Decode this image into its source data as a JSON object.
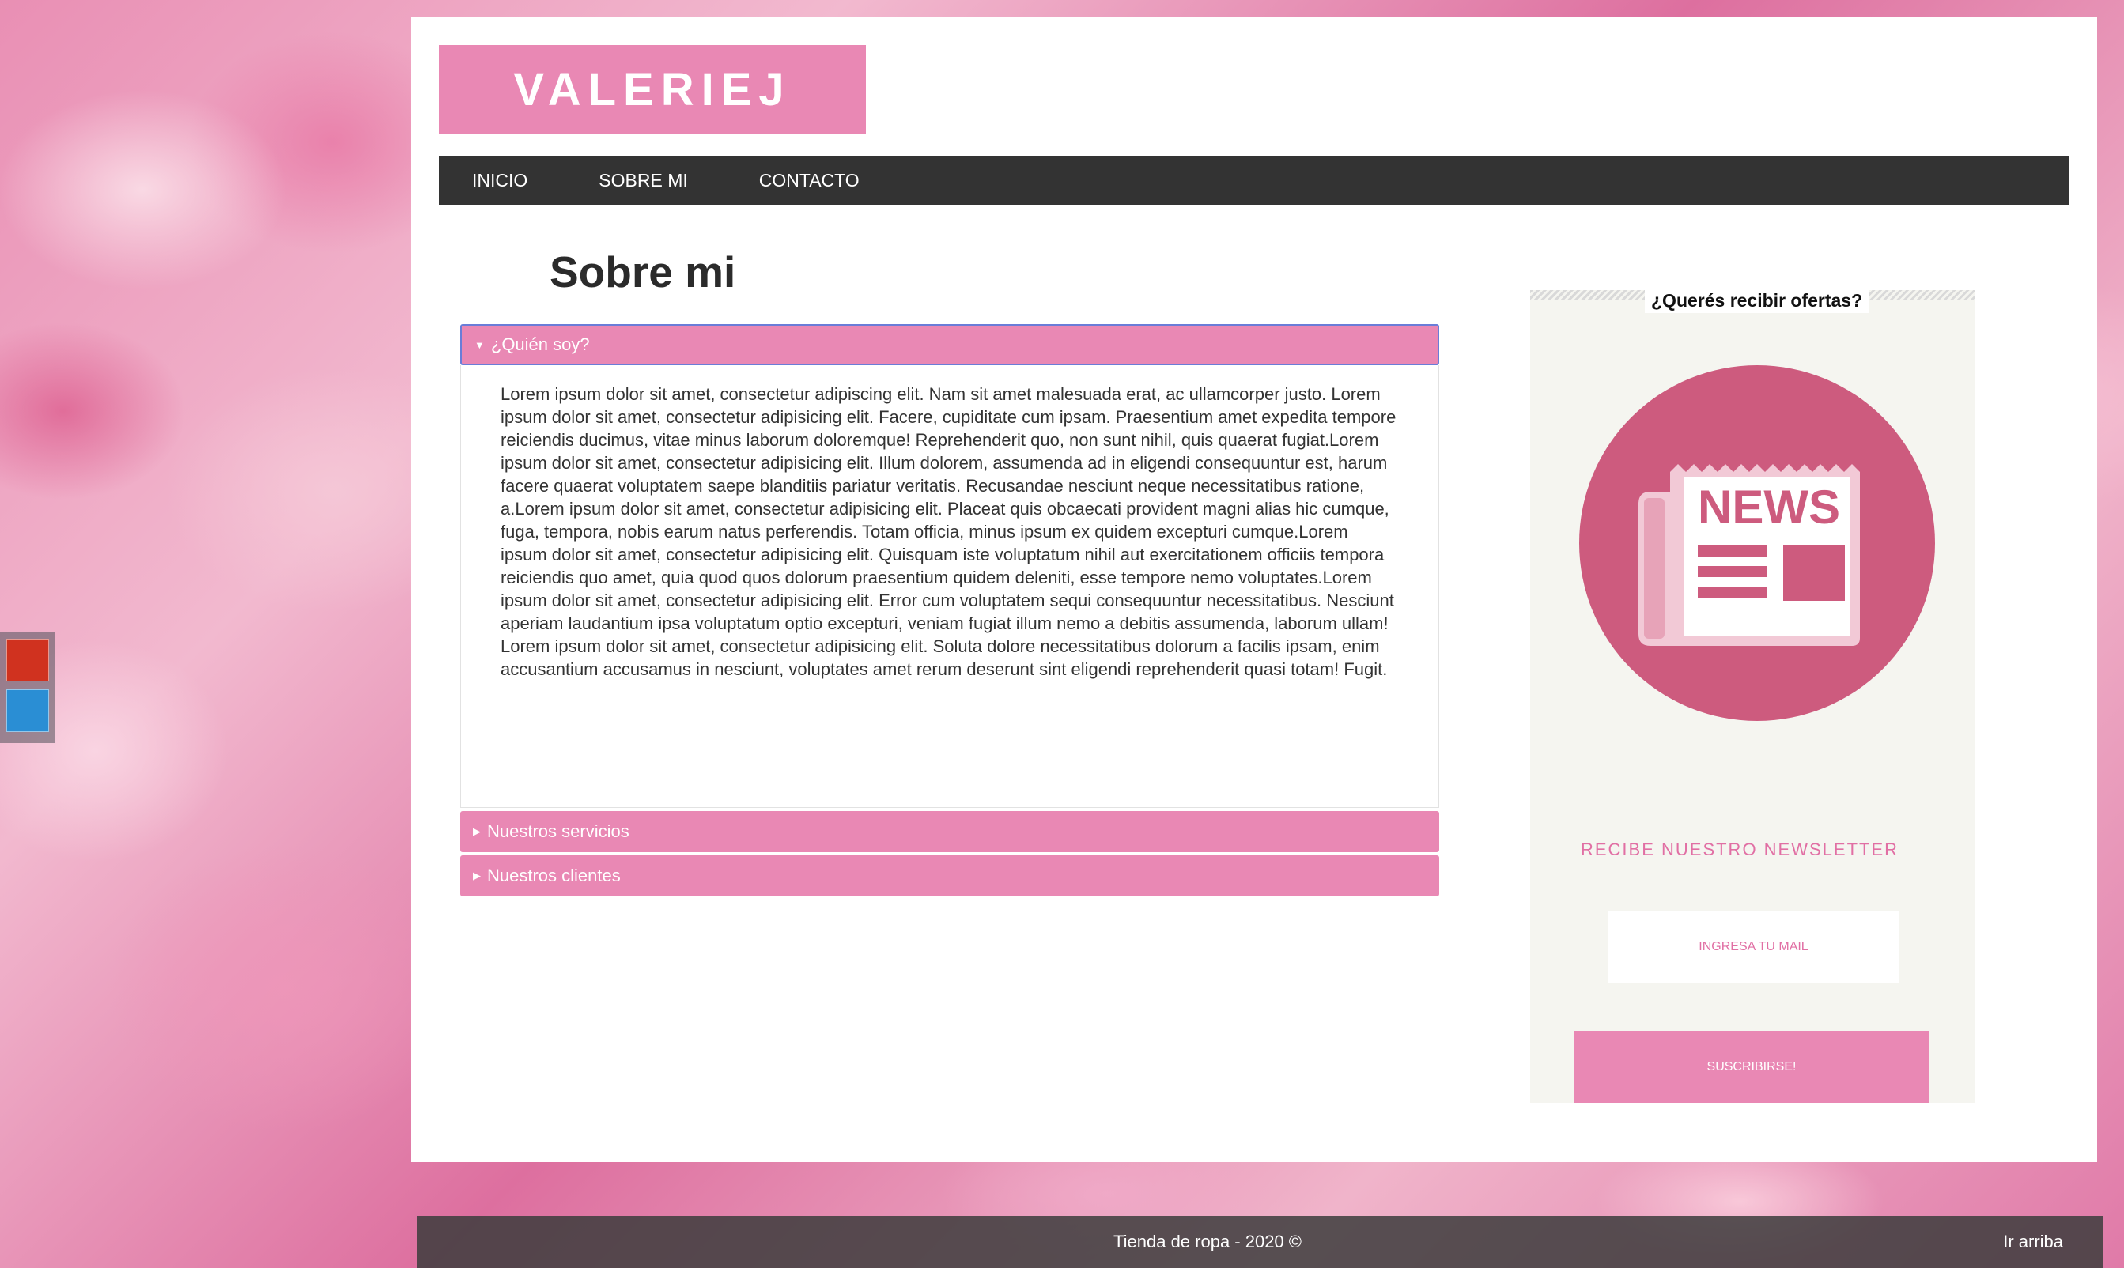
{
  "brand": {
    "logo_text": "VALERIEJ"
  },
  "nav": {
    "items": [
      {
        "label": "INICIO"
      },
      {
        "label": "SOBRE MI"
      },
      {
        "label": "CONTACTO"
      }
    ]
  },
  "main": {
    "title": "Sobre mi",
    "accordion": [
      {
        "label": "¿Quién soy?",
        "expanded": true,
        "content": "Lorem ipsum dolor sit amet, consectetur adipiscing elit. Nam sit amet malesuada erat, ac ullamcorper justo. Lorem ipsum dolor sit amet, consectetur adipisicing elit. Facere, cupiditate cum ipsam. Praesentium amet expedita tempore reiciendis ducimus, vitae minus laborum doloremque! Reprehenderit quo, non sunt nihil, quis quaerat fugiat.Lorem ipsum dolor sit amet, consectetur adipisicing elit. Illum dolorem, assumenda ad in eligendi consequuntur est, harum facere quaerat voluptatem saepe blanditiis pariatur veritatis. Recusandae nesciunt neque necessitatibus ratione, a.Lorem ipsum dolor sit amet, consectetur adipisicing elit. Placeat quis obcaecati provident magni alias hic cumque, fuga, tempora, nobis earum natus perferendis. Totam officia, minus ipsum ex quidem excepturi cumque.Lorem ipsum dolor sit amet, consectetur adipisicing elit. Quisquam iste voluptatum nihil aut exercitationem officiis tempora reiciendis quo amet, quia quod quos dolorum praesentium quidem deleniti, esse tempore nemo voluptates.Lorem ipsum dolor sit amet, consectetur adipisicing elit. Error cum voluptatem sequi consequuntur necessitatibus. Nesciunt aperiam laudantium ipsa voluptatum optio excepturi, veniam fugiat illum nemo a debitis assumenda, laborum ullam! Lorem ipsum dolor sit amet, consectetur adipisicing elit. Soluta dolore necessitatibus dolorum a facilis ipsam, enim accusantium accusamus in nesciunt, voluptates amet rerum deserunt sint eligendi reprehenderit quasi totam! Fugit."
      },
      {
        "label": "Nuestros servicios",
        "expanded": false
      },
      {
        "label": "Nuestros clientes",
        "expanded": false
      }
    ]
  },
  "sidebar": {
    "title": "¿Querés recibir ofertas?",
    "icon_text": "NEWS",
    "newsletter_label": "RECIBE NUESTRO NEWSLETTER",
    "email_placeholder": "INGRESA TU MAIL",
    "subscribe_label": "SUSCRIBIRSE!"
  },
  "footer": {
    "text": "Tienda de ropa - 2020 ©",
    "back_to_top": "Ir arriba"
  },
  "colors": {
    "accent": "#e988b4",
    "nav_bg": "#333333",
    "icon_circle": "#cd5b7e"
  }
}
